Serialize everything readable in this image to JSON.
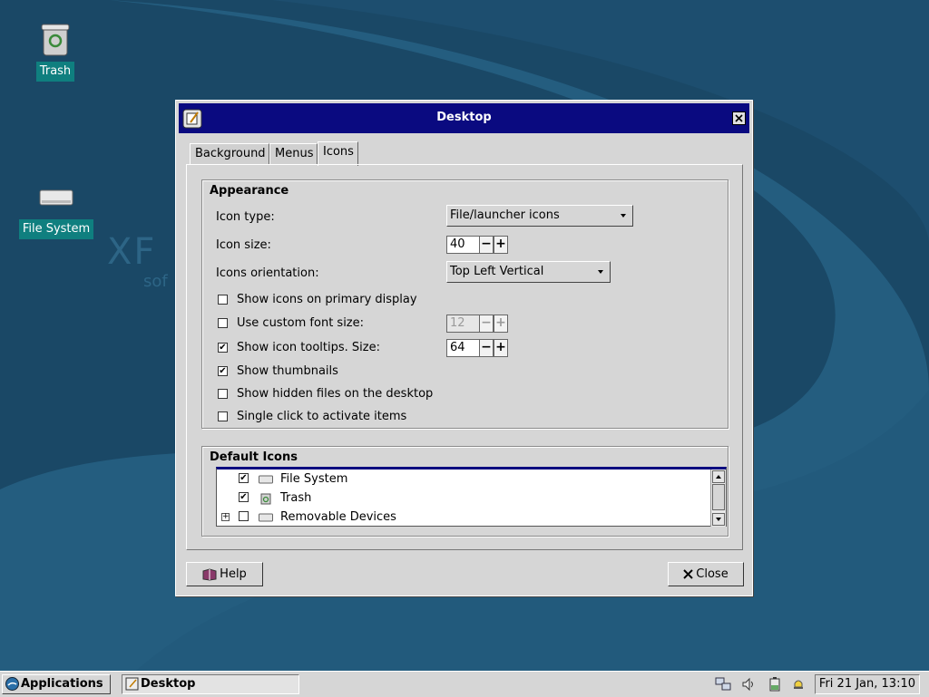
{
  "desktop": {
    "icons": [
      {
        "label": "Trash",
        "icon": "trash-icon"
      },
      {
        "label": "File System",
        "icon": "drive-icon"
      }
    ],
    "watermark": {
      "text": "XF",
      "sub": "sof"
    },
    "background_colors": {
      "dark": "#1a4866",
      "light": "#225a7c"
    }
  },
  "dialog": {
    "title": "Desktop",
    "tabs": [
      {
        "label": "Background",
        "active": false
      },
      {
        "label": "Menus",
        "active": false
      },
      {
        "label": "Icons",
        "active": true
      }
    ],
    "appearance": {
      "title": "Appearance",
      "icon_type_label": "Icon type:",
      "icon_type_value": "File/launcher icons",
      "icon_size_label": "Icon size:",
      "icon_size_value": "40",
      "orientation_label": "Icons orientation:",
      "orientation_value": "Top Left Vertical",
      "checks": {
        "primary_display": {
          "label": "Show icons on primary display",
          "checked": false
        },
        "custom_font": {
          "label": "Use custom font size:",
          "checked": false,
          "value": "12"
        },
        "tooltips": {
          "label": "Show icon tooltips. Size:",
          "checked": true,
          "value": "64"
        },
        "thumbnails": {
          "label": "Show thumbnails",
          "checked": true
        },
        "hidden_files": {
          "label": "Show hidden files on the desktop",
          "checked": false
        },
        "single_click": {
          "label": "Single click to activate items",
          "checked": false
        }
      }
    },
    "default_icons": {
      "title": "Default Icons",
      "items": [
        {
          "label": "File System",
          "checked": true,
          "expandable": false,
          "icon": "drive-icon"
        },
        {
          "label": "Trash",
          "checked": true,
          "expandable": false,
          "icon": "trash-icon"
        },
        {
          "label": "Removable Devices",
          "checked": false,
          "expandable": true,
          "icon": "drive-icon"
        }
      ]
    },
    "help_label": "Help",
    "close_label": "Close",
    "title_color": "#0a0a80"
  },
  "taskbar": {
    "applications_label": "Applications",
    "window_label": "Desktop",
    "clock": "Fri 21 Jan, 13:10",
    "tray_icons": [
      "network-icon",
      "volume-icon",
      "battery-icon",
      "notification-bell-icon"
    ]
  }
}
